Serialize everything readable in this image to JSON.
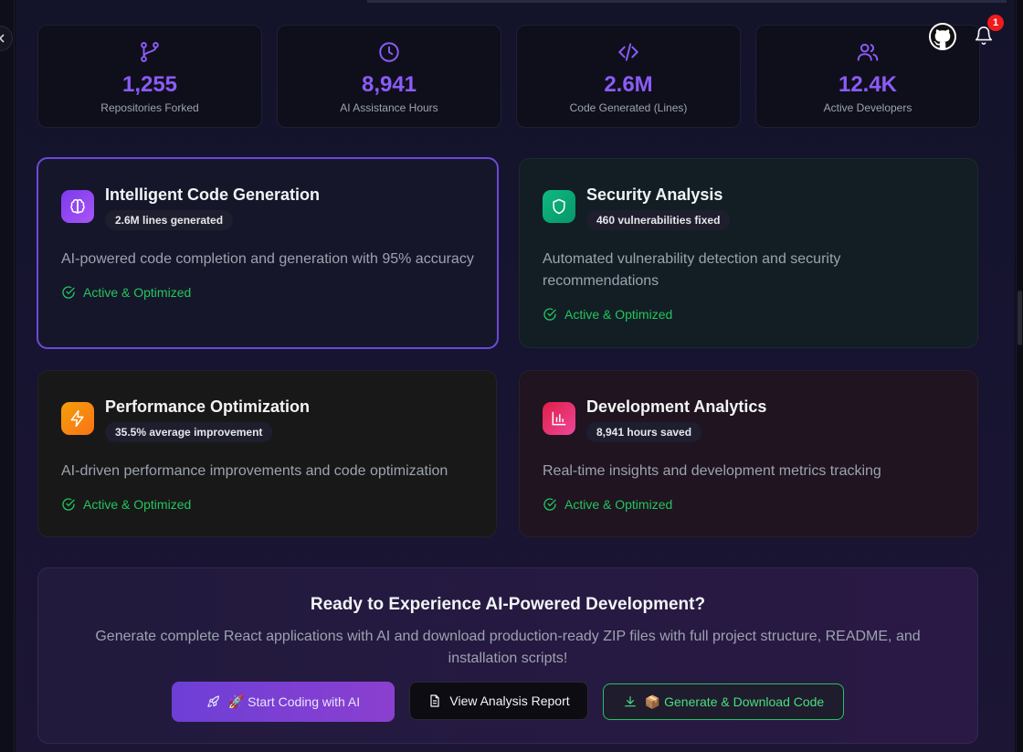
{
  "stats": [
    {
      "icon": "git-fork-icon",
      "value": "1,255",
      "label": "Repositories Forked"
    },
    {
      "icon": "clock-icon",
      "value": "8,941",
      "label": "AI Assistance Hours"
    },
    {
      "icon": "code-icon",
      "value": "2.6M",
      "label": "Code Generated (Lines)"
    },
    {
      "icon": "users-icon",
      "value": "12.4K",
      "label": "Active Developers"
    }
  ],
  "features": [
    {
      "icon": "brain-icon",
      "title": "Intelligent Code Generation",
      "badge": "2.6M lines generated",
      "description": "AI-powered code completion and generation with 95% accuracy",
      "status": "Active & Optimized",
      "color": "#7c3aed"
    },
    {
      "icon": "shield-icon",
      "title": "Security Analysis",
      "badge": "460 vulnerabilities fixed",
      "description": "Automated vulnerability detection and security recommendations",
      "status": "Active & Optimized",
      "color": "#10b981"
    },
    {
      "icon": "zap-icon",
      "title": "Performance Optimization",
      "badge": "35.5% average improvement",
      "description": "AI-driven performance improvements and code optimization",
      "status": "Active & Optimized",
      "color": "#f97316"
    },
    {
      "icon": "bar-chart-icon",
      "title": "Development Analytics",
      "badge": "8,941 hours saved",
      "description": "Real-time insights and development metrics tracking",
      "status": "Active & Optimized",
      "color": "#e11d48"
    }
  ],
  "cta": {
    "title": "Ready to Experience AI-Powered Development?",
    "description": "Generate complete React applications with AI and download production-ready ZIP files with full project structure, README, and installation scripts!",
    "start_label": "🚀 Start Coding with AI",
    "report_label": "View Analysis Report",
    "download_label": "📦 Generate & Download Code"
  },
  "header": {
    "notification_count": "1"
  },
  "colors": {
    "accent": "#8b5cf6",
    "success": "#22c55e"
  }
}
